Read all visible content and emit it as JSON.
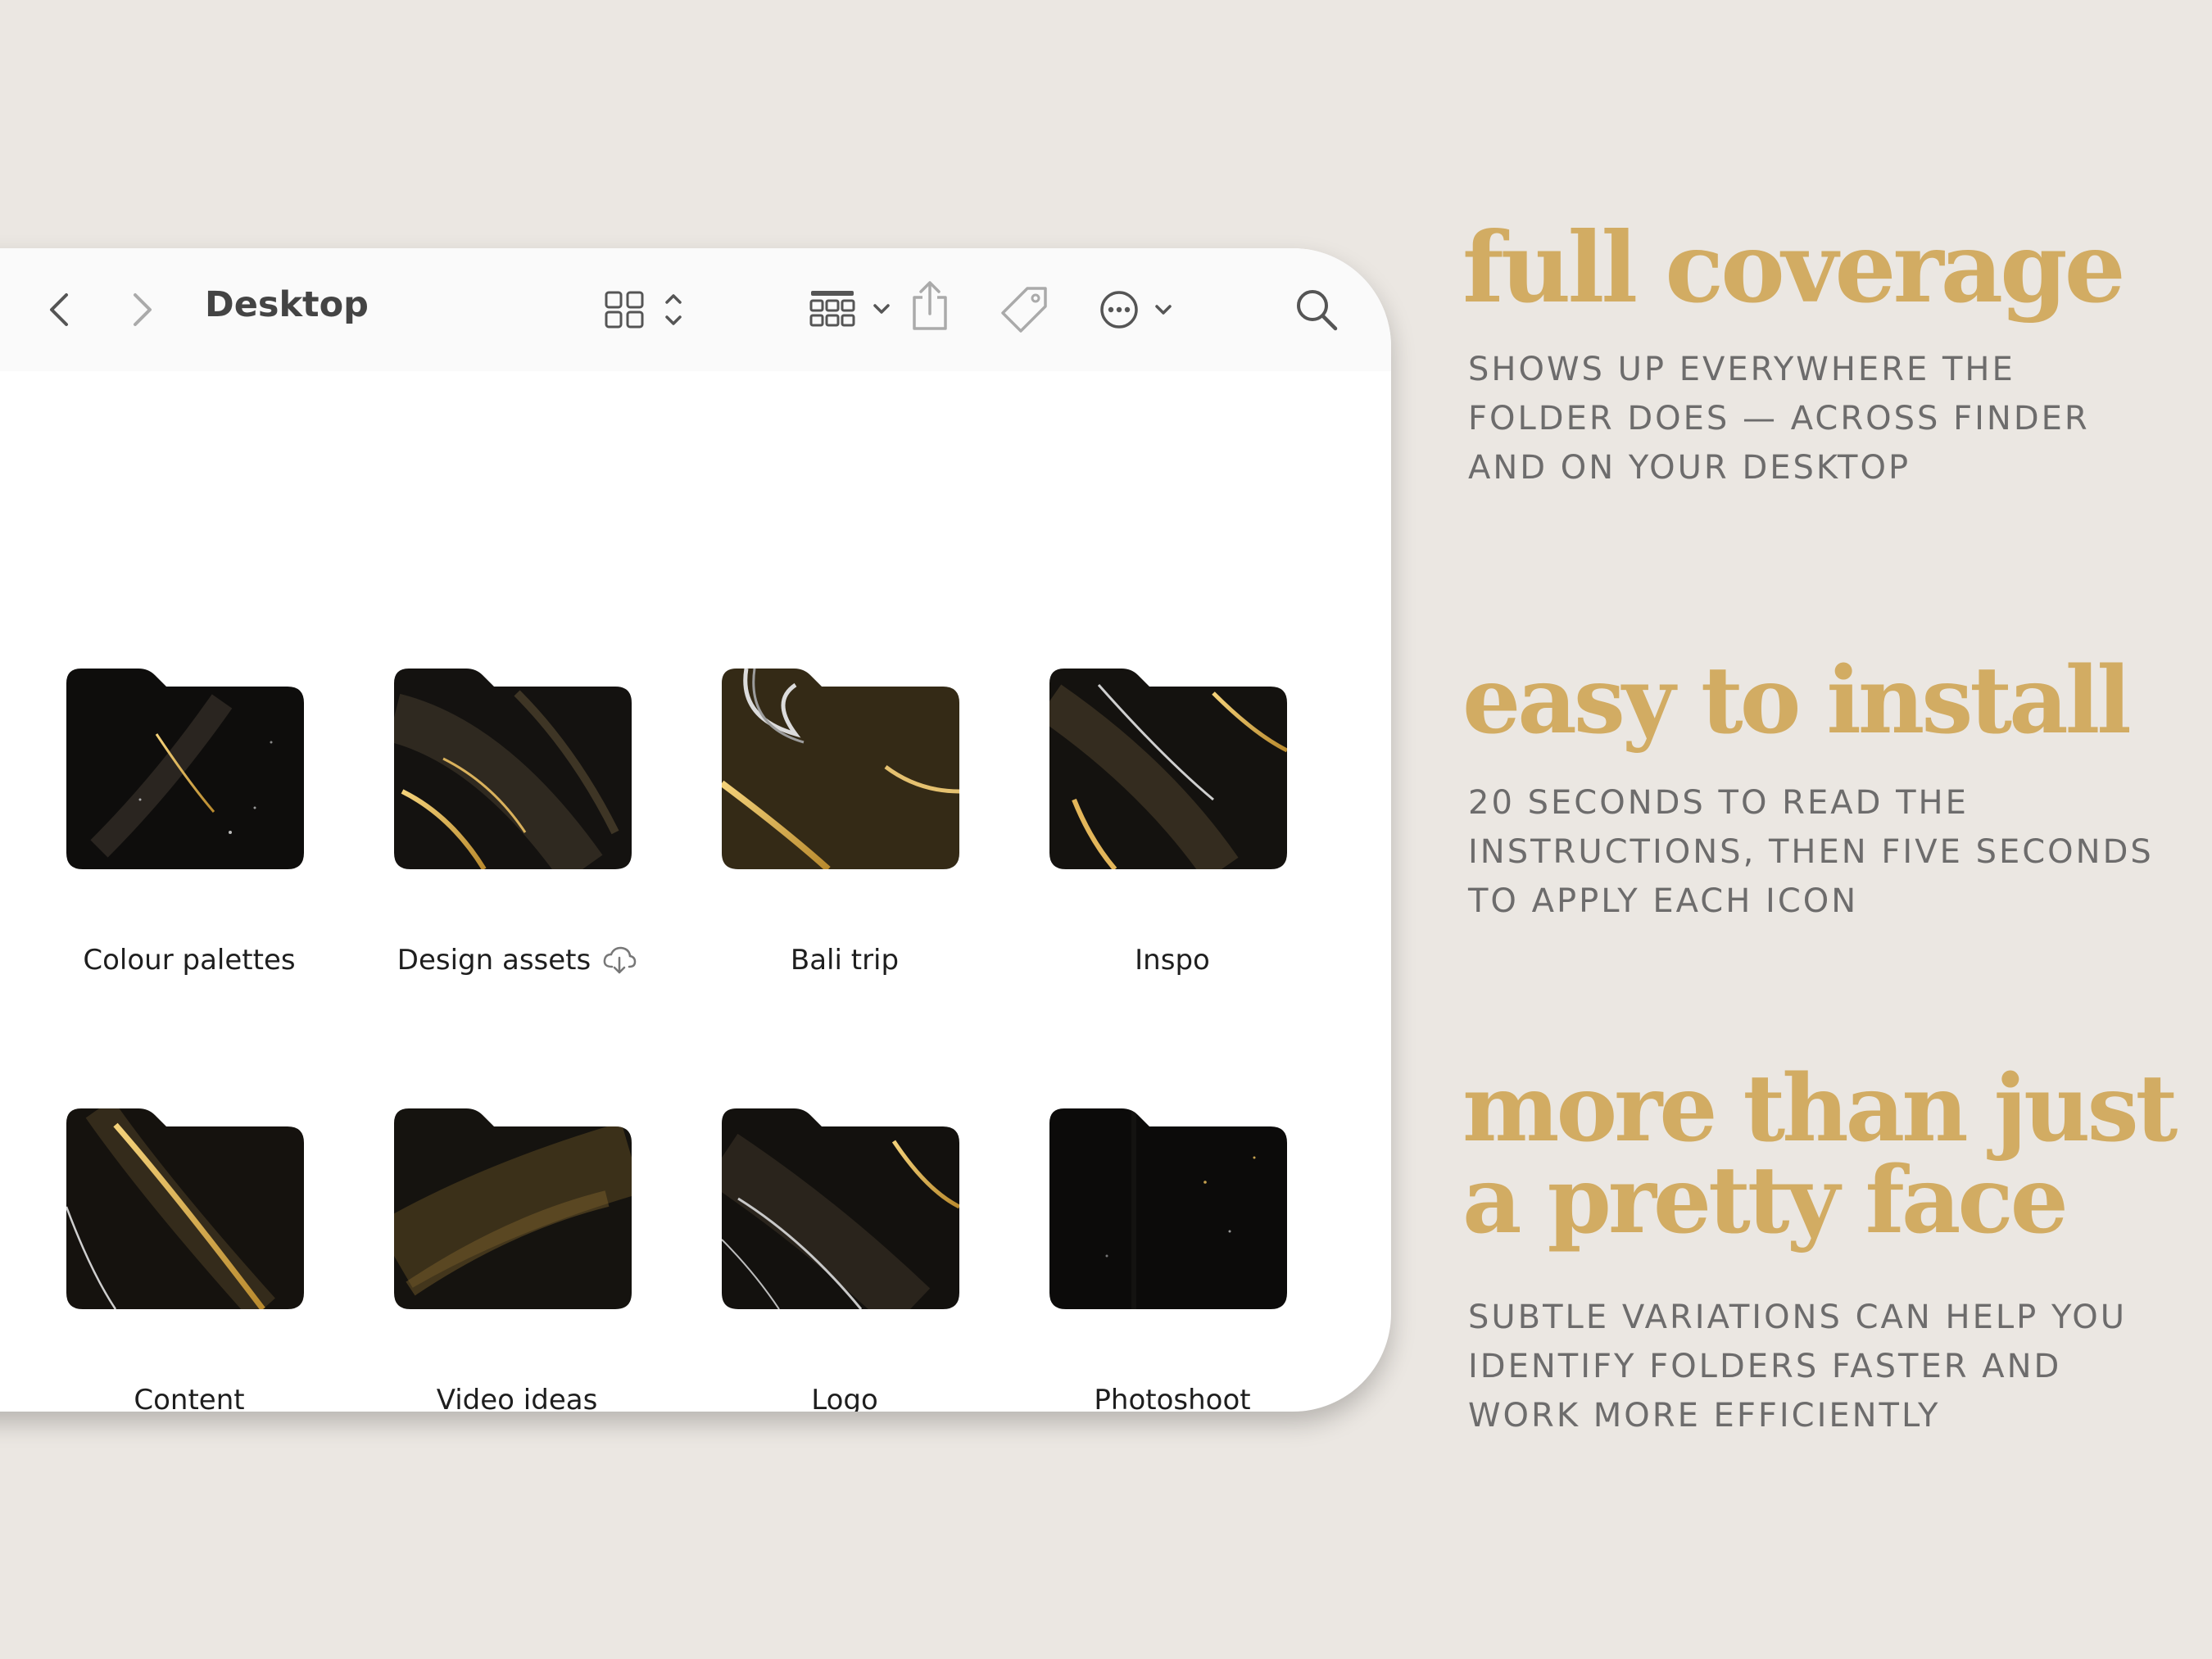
{
  "window": {
    "title": "Desktop"
  },
  "toolbar": {
    "back_icon": "chevron-left-icon",
    "forward_icon": "chevron-right-icon",
    "view_icon": "icon-grid-view-icon",
    "group_icon": "group-by-icon",
    "share_icon": "share-icon",
    "tag_icon": "tag-icon",
    "more_icon": "ellipsis-circle-icon",
    "search_icon": "search-icon"
  },
  "folders": [
    {
      "label": "Colour palettes",
      "cloud": false
    },
    {
      "label": "Design assets",
      "cloud": true
    },
    {
      "label": "Bali trip",
      "cloud": false
    },
    {
      "label": "Inspo",
      "cloud": false
    },
    {
      "label": "Content",
      "cloud": false
    },
    {
      "label": "Video ideas",
      "cloud": false
    },
    {
      "label": "Logo",
      "cloud": false
    },
    {
      "label": "Photoshoot",
      "cloud": false
    }
  ],
  "features": [
    {
      "heading": "full coverage",
      "body": "SHOWS UP EVERYWHERE THE FOLDER DOES — ACROSS FINDER AND ON YOUR DESKTOP"
    },
    {
      "heading": "easy to install",
      "body": "20 SECONDS TO READ THE INSTRUCTIONS, THEN FIVE SECONDS TO APPLY EACH ICON"
    },
    {
      "heading_line1": "more than just",
      "heading_line2": "a pretty face",
      "body": "SUBTLE VARIATIONS CAN HELP YOU IDENTIFY FOLDERS FASTER AND WORK MORE EFFICIENTLY"
    }
  ],
  "colors": {
    "background": "#ebe7e2",
    "accent_gold": "#d2ac63",
    "body_text": "#6d6c6c",
    "folder_dark": "#0d0c0b"
  }
}
